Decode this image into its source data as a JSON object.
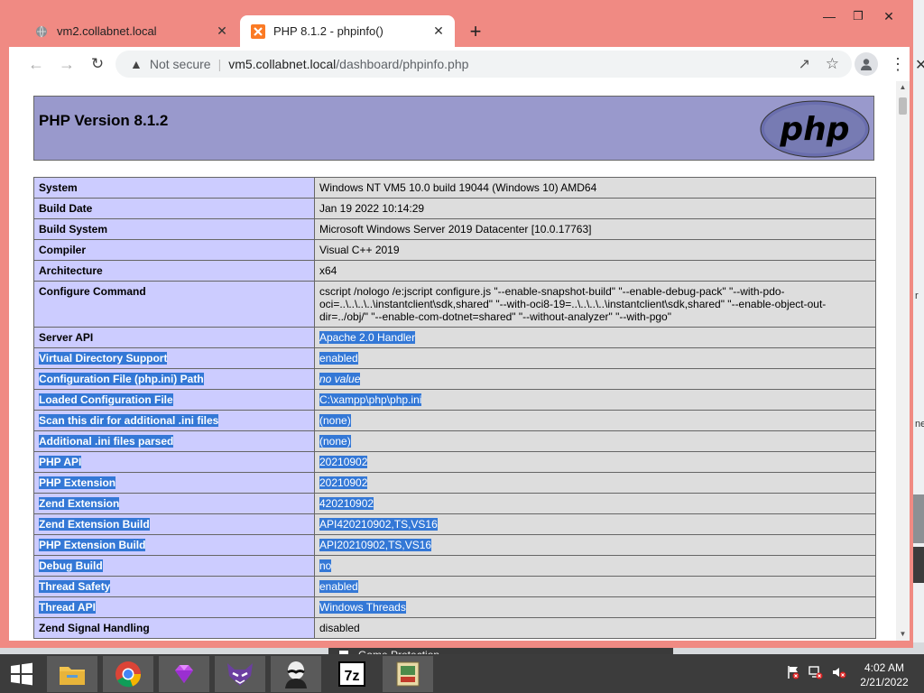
{
  "browser": {
    "tabs": [
      {
        "title": "vm2.collabnet.local",
        "active": false,
        "icon": "globe-icon"
      },
      {
        "title": "PHP 8.1.2 - phpinfo()",
        "active": true,
        "icon": "xampp-icon"
      }
    ],
    "omnibox": {
      "security_label": "Not secure",
      "url_host": "vm5.collabnet.local",
      "url_path": "/dashboard/phpinfo.php"
    }
  },
  "page": {
    "heading": "PHP Version 8.1.2",
    "logo_text": "php",
    "rows": [
      {
        "key": "System",
        "value": "Windows NT VM5 10.0 build 19044 (Windows 10) AMD64",
        "selected": false
      },
      {
        "key": "Build Date",
        "value": "Jan 19 2022 10:14:29",
        "selected": false
      },
      {
        "key": "Build System",
        "value": "Microsoft Windows Server 2019 Datacenter [10.0.17763]",
        "selected": false
      },
      {
        "key": "Compiler",
        "value": "Visual C++ 2019",
        "selected": false
      },
      {
        "key": "Architecture",
        "value": "x64",
        "selected": false
      },
      {
        "key": "Configure Command",
        "value": "cscript /nologo /e:jscript configure.js \"--enable-snapshot-build\" \"--enable-debug-pack\" \"--with-pdo-oci=..\\..\\..\\..\\instantclient\\sdk,shared\" \"--with-oci8-19=..\\..\\..\\..\\instantclient\\sdk,shared\" \"--enable-object-out-dir=../obj/\" \"--enable-com-dotnet=shared\" \"--without-analyzer\" \"--with-pgo\"",
        "selected": false
      },
      {
        "key": "Server API",
        "value": "Apache 2.0 Handler",
        "selected": "value"
      },
      {
        "key": "Virtual Directory Support",
        "value": "enabled",
        "selected": true
      },
      {
        "key": "Configuration File (php.ini) Path",
        "value": "no value",
        "selected": true,
        "italic": true
      },
      {
        "key": "Loaded Configuration File",
        "value": "C:\\xampp\\php\\php.ini",
        "selected": true
      },
      {
        "key": "Scan this dir for additional .ini files",
        "value": "(none)",
        "selected": true
      },
      {
        "key": "Additional .ini files parsed",
        "value": "(none)",
        "selected": true
      },
      {
        "key": "PHP API",
        "value": "20210902",
        "selected": true
      },
      {
        "key": "PHP Extension",
        "value": "20210902",
        "selected": true
      },
      {
        "key": "Zend Extension",
        "value": "420210902",
        "selected": true
      },
      {
        "key": "Zend Extension Build",
        "value": "API420210902,TS,VS16",
        "selected": true
      },
      {
        "key": "PHP Extension Build",
        "value": "API20210902,TS,VS16",
        "selected": true
      },
      {
        "key": "Debug Build",
        "value": "no",
        "selected": true
      },
      {
        "key": "Thread Safety",
        "value": "enabled",
        "selected": true
      },
      {
        "key": "Thread API",
        "value": "Windows Threads",
        "selected": true
      },
      {
        "key": "Zend Signal Handling",
        "value": "disabled",
        "selected": false
      }
    ]
  },
  "popup_fragment": {
    "label": "Game Protection"
  },
  "taskbar": {
    "apps": [
      "file-explorer-icon",
      "chrome-icon",
      "gem-app-icon",
      "cat-app-icon",
      "hacker-app-icon",
      "7zip-icon",
      "xampp-control-icon"
    ],
    "clock_time": "4:02 AM",
    "clock_date": "2/21/2022"
  },
  "colors": {
    "window_frame": "#f08a83",
    "php_header": "#9999cc",
    "key_cell": "#ccccff",
    "value_cell": "#dddddd",
    "selection": "#3478d6"
  }
}
